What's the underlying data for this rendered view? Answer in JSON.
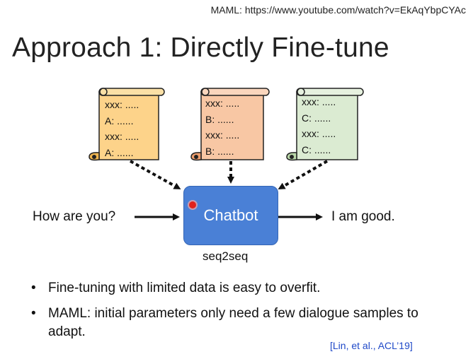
{
  "reference_url": "MAML: https://www.youtube.com/watch?v=EkAqYbpCYAc",
  "title": "Approach 1: Directly Fine-tune",
  "scrolls": [
    {
      "lines": [
        "xxx: .....",
        "A: ......",
        "xxx: .....",
        "A: ......"
      ],
      "color": "#fdd38a"
    },
    {
      "lines": [
        "xxx: .....",
        "B: ......",
        "xxx: .....",
        "B: ......"
      ],
      "color": "#f8c7a4"
    },
    {
      "lines": [
        "xxx: .....",
        "C: ......",
        "xxx: .....",
        "C: ......"
      ],
      "color": "#dbebd2"
    }
  ],
  "chatbot": {
    "label": "Chatbot",
    "caption": "seq2seq",
    "color": "#4a80d6"
  },
  "input_text": "How are you?",
  "output_text": "I am good.",
  "bullets": [
    "Fine-tuning with limited data is easy to overfit.",
    "MAML: initial parameters only need a few dialogue samples to adapt."
  ],
  "citation": "[Lin, et al., ACL’19]",
  "accent_colors": {
    "citation": "#1f49c8",
    "cursor": "#e0211c"
  }
}
